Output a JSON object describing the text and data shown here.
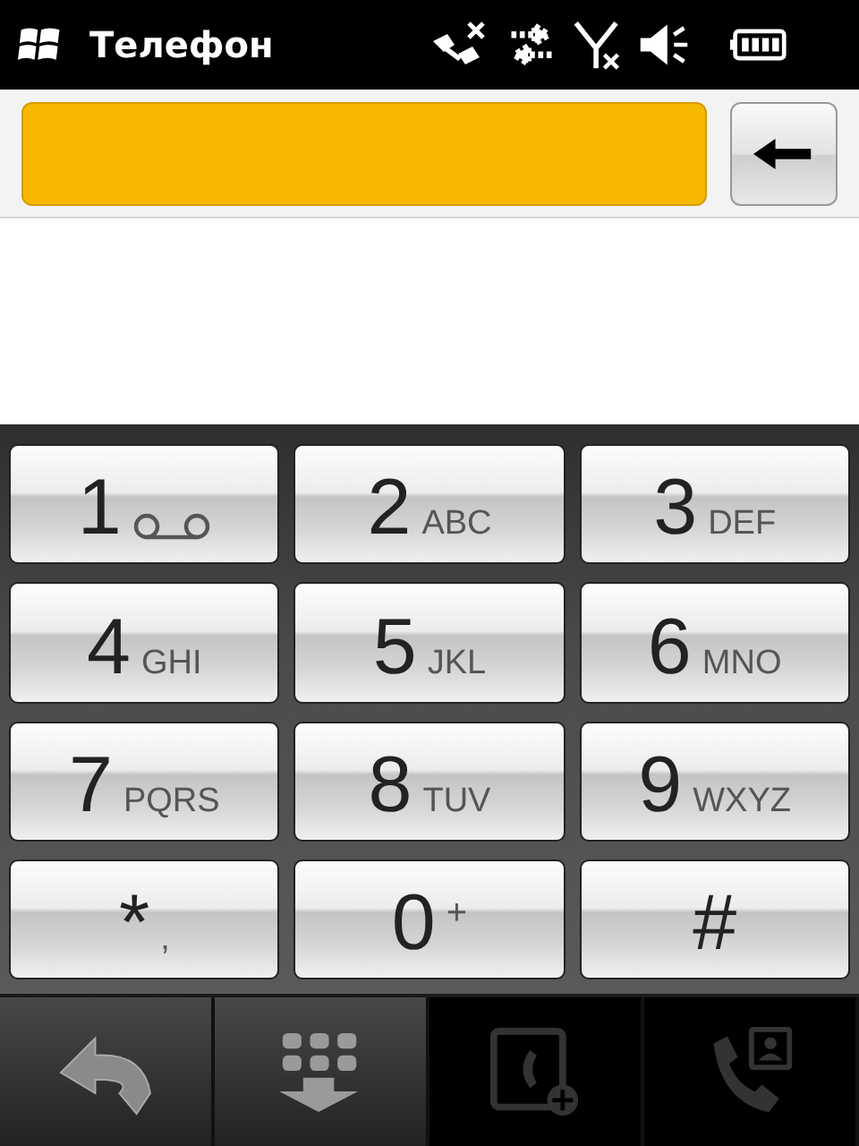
{
  "status_bar": {
    "title": "Телефон"
  },
  "keys": [
    {
      "digit": "1",
      "kind": "voicemail"
    },
    {
      "digit": "2",
      "letters": "ABC",
      "kind": "letters"
    },
    {
      "digit": "3",
      "letters": "DEF",
      "kind": "letters"
    },
    {
      "digit": "4",
      "letters": "GHI",
      "kind": "letters"
    },
    {
      "digit": "5",
      "letters": "JKL",
      "kind": "letters"
    },
    {
      "digit": "6",
      "letters": "MNO",
      "kind": "letters"
    },
    {
      "digit": "7",
      "letters": "PQRS",
      "kind": "letters"
    },
    {
      "digit": "8",
      "letters": "TUV",
      "kind": "letters"
    },
    {
      "digit": "9",
      "letters": "WXYZ",
      "kind": "letters"
    },
    {
      "digit": "*",
      "letters": ",",
      "kind": "letters"
    },
    {
      "digit": "0",
      "letters": "+",
      "kind": "raised"
    },
    {
      "digit": "#",
      "kind": "plain"
    }
  ],
  "toolbar": [
    {
      "kind": "back",
      "disabled": false
    },
    {
      "kind": "hide-keypad",
      "disabled": false
    },
    {
      "kind": "add-contact",
      "disabled": true
    },
    {
      "kind": "call-contact",
      "disabled": true
    }
  ]
}
